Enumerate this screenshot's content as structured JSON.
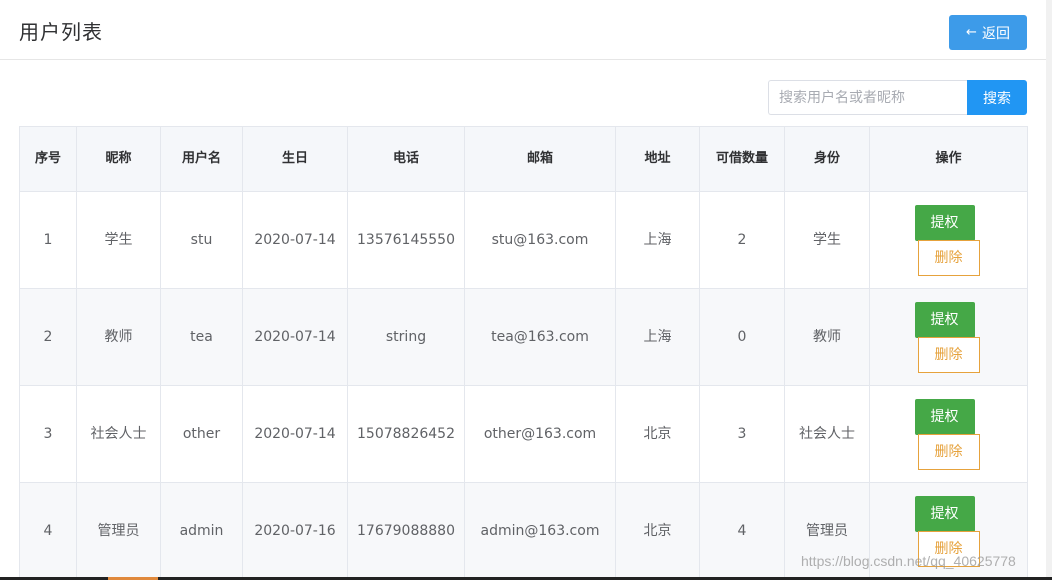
{
  "header": {
    "title": "用户列表",
    "back_label": "返回",
    "back_icon": "arrow-left-icon"
  },
  "search": {
    "placeholder": "搜索用户名或者昵称",
    "value": "",
    "button_label": "搜索"
  },
  "table": {
    "columns": [
      "序号",
      "昵称",
      "用户名",
      "生日",
      "电话",
      "邮箱",
      "地址",
      "可借数量",
      "身份",
      "操作"
    ],
    "rows": [
      {
        "index": "1",
        "nickname": "学生",
        "username": "stu",
        "birthday": "2020-07-14",
        "phone": "13576145550",
        "email": "stu@163.com",
        "address": "上海",
        "quota": "2",
        "role": "学生"
      },
      {
        "index": "2",
        "nickname": "教师",
        "username": "tea",
        "birthday": "2020-07-14",
        "phone": "string",
        "email": "tea@163.com",
        "address": "上海",
        "quota": "0",
        "role": "教师"
      },
      {
        "index": "3",
        "nickname": "社会人士",
        "username": "other",
        "birthday": "2020-07-14",
        "phone": "15078826452",
        "email": "other@163.com",
        "address": "北京",
        "quota": "3",
        "role": "社会人士"
      },
      {
        "index": "4",
        "nickname": "管理员",
        "username": "admin",
        "birthday": "2020-07-16",
        "phone": "17679088880",
        "email": "admin@163.com",
        "address": "北京",
        "quota": "4",
        "role": "管理员"
      }
    ],
    "actions": {
      "grant_label": "提权",
      "delete_label": "删除"
    }
  },
  "watermark": "https://blog.csdn.net/qq_40625778",
  "colors": {
    "primary": "#3d9be9",
    "search": "#2196f3",
    "grant": "#45a847",
    "delete": "#e6a23c"
  }
}
